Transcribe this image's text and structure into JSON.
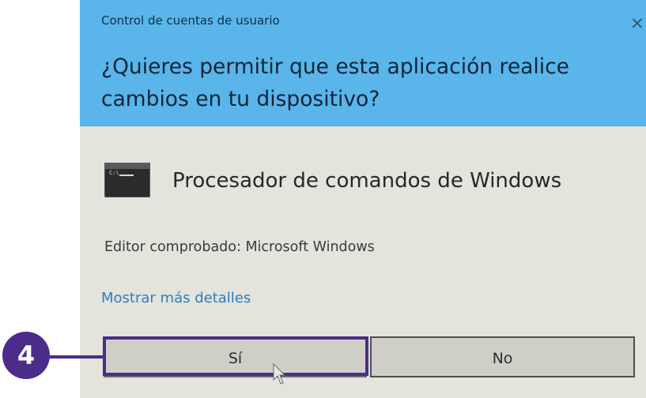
{
  "dialog": {
    "title": "Control de cuentas de usuario",
    "close_icon": "close-icon",
    "question": "¿Quieres permitir que esta aplicación realice cambios en tu dispositivo?",
    "app": {
      "icon": "command-prompt-icon",
      "name": "Procesador de comandos de Windows"
    },
    "publisher": "Editor comprobado: Microsoft Windows",
    "details_link": "Mostrar más detalles",
    "buttons": {
      "yes": "Sí",
      "no": "No"
    }
  },
  "annotation": {
    "step_number": "4",
    "color": "#4c2c8a"
  },
  "colors": {
    "header": "#59b5ea",
    "body": "#e4e3dc",
    "link": "#2d7fbe"
  }
}
